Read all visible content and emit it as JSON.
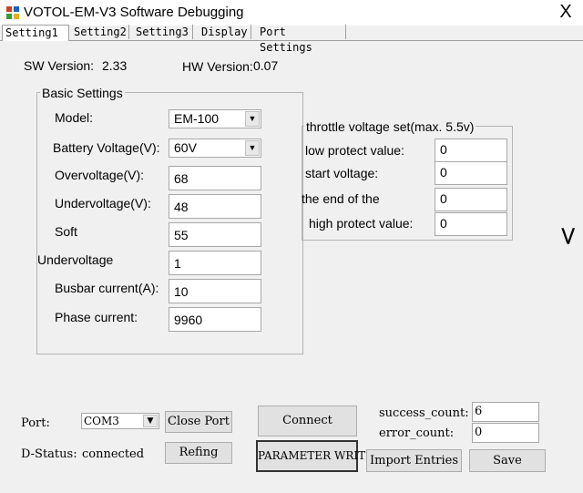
{
  "window": {
    "title": "VOTOL-EM-V3 Software Debugging",
    "close_glyph": "X"
  },
  "tabs": [
    "Setting1",
    "Setting2",
    "Setting3",
    "Display",
    "Port Settings"
  ],
  "versions": {
    "sw_label": "SW Version:",
    "sw_value": "2.33",
    "hw_label": "HW Version:",
    "hw_value": "0.07"
  },
  "basic": {
    "title": "Basic Settings",
    "model_label": "Model:",
    "model_value": "EM-100",
    "battery_label": "Battery Voltage(V):",
    "battery_value": "60V",
    "over_label": "Overvoltage(V):",
    "over_value": "68",
    "under_label": "Undervoltage(V):",
    "under_value": "48",
    "soft_label": "Soft",
    "soft_value": "55",
    "soft_under_label": "Undervoltage",
    "soft_under_value": "1",
    "busbar_label": "Busbar current(A):",
    "busbar_value": "10",
    "phase_label": "Phase current:",
    "phase_value": "9960"
  },
  "throttle": {
    "title": "throttle voltage set(max. 5.5v)",
    "low_label": "low protect value:",
    "low_value": "0",
    "start_label": "start voltage:",
    "start_value": "0",
    "end_label": "the end of the",
    "end_value": "0",
    "high_label": "high protect value:",
    "high_value": "0"
  },
  "side_arrow": ">",
  "bottom": {
    "port_label": "Port:",
    "port_value": "COM3",
    "close_port": "Close Port",
    "dstatus_label": "D-Status:",
    "dstatus_value": "connected",
    "refing": "Refing",
    "connect": "Connect",
    "param_write": "PARAMETER WRITE",
    "success_label": "success_count:",
    "success_value": "6",
    "error_label": "error_count:",
    "error_value": "0",
    "import": "Import Entries",
    "save": "Save"
  },
  "colors": {
    "background": "#f0f0f0",
    "field": "#ffffff",
    "button": "#e1e1e1"
  }
}
